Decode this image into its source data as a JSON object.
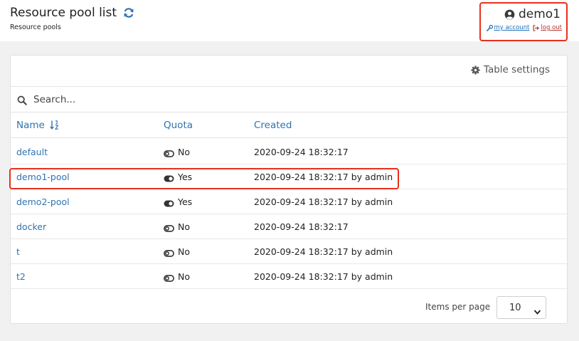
{
  "header": {
    "title": "Resource pool list",
    "subtitle": "Resource pools",
    "refresh_icon": "refresh-icon"
  },
  "user": {
    "name": "demo1",
    "my_account_label": "my account",
    "log_out_label": "log out",
    "icon": "user-circle-icon"
  },
  "toolbar": {
    "table_settings_label": "Table settings",
    "icon": "gear-icon"
  },
  "search": {
    "placeholder": "Search...",
    "value": ""
  },
  "table": {
    "columns": [
      "Name",
      "Quota",
      "Created"
    ],
    "sort_icon": "sort-alpha-down-icon",
    "rows": [
      {
        "name": "default",
        "quota": "No",
        "quota_on": false,
        "created": "2020-09-24 18:32:17"
      },
      {
        "name": "demo1-pool",
        "quota": "Yes",
        "quota_on": true,
        "created": "2020-09-24 18:32:17 by admin"
      },
      {
        "name": "demo2-pool",
        "quota": "Yes",
        "quota_on": true,
        "created": "2020-09-24 18:32:17 by admin"
      },
      {
        "name": "docker",
        "quota": "No",
        "quota_on": false,
        "created": "2020-09-24 18:32:17"
      },
      {
        "name": "t",
        "quota": "No",
        "quota_on": false,
        "created": "2020-09-24 18:32:17 by admin"
      },
      {
        "name": "t2",
        "quota": "No",
        "quota_on": false,
        "created": "2020-09-24 18:32:17 by admin"
      }
    ]
  },
  "pagination": {
    "items_per_page_label": "Items per page",
    "items_per_page_value": "10"
  },
  "colors": {
    "link": "#2f73b0",
    "highlight": "#e8301c",
    "logout": "#b23535"
  }
}
